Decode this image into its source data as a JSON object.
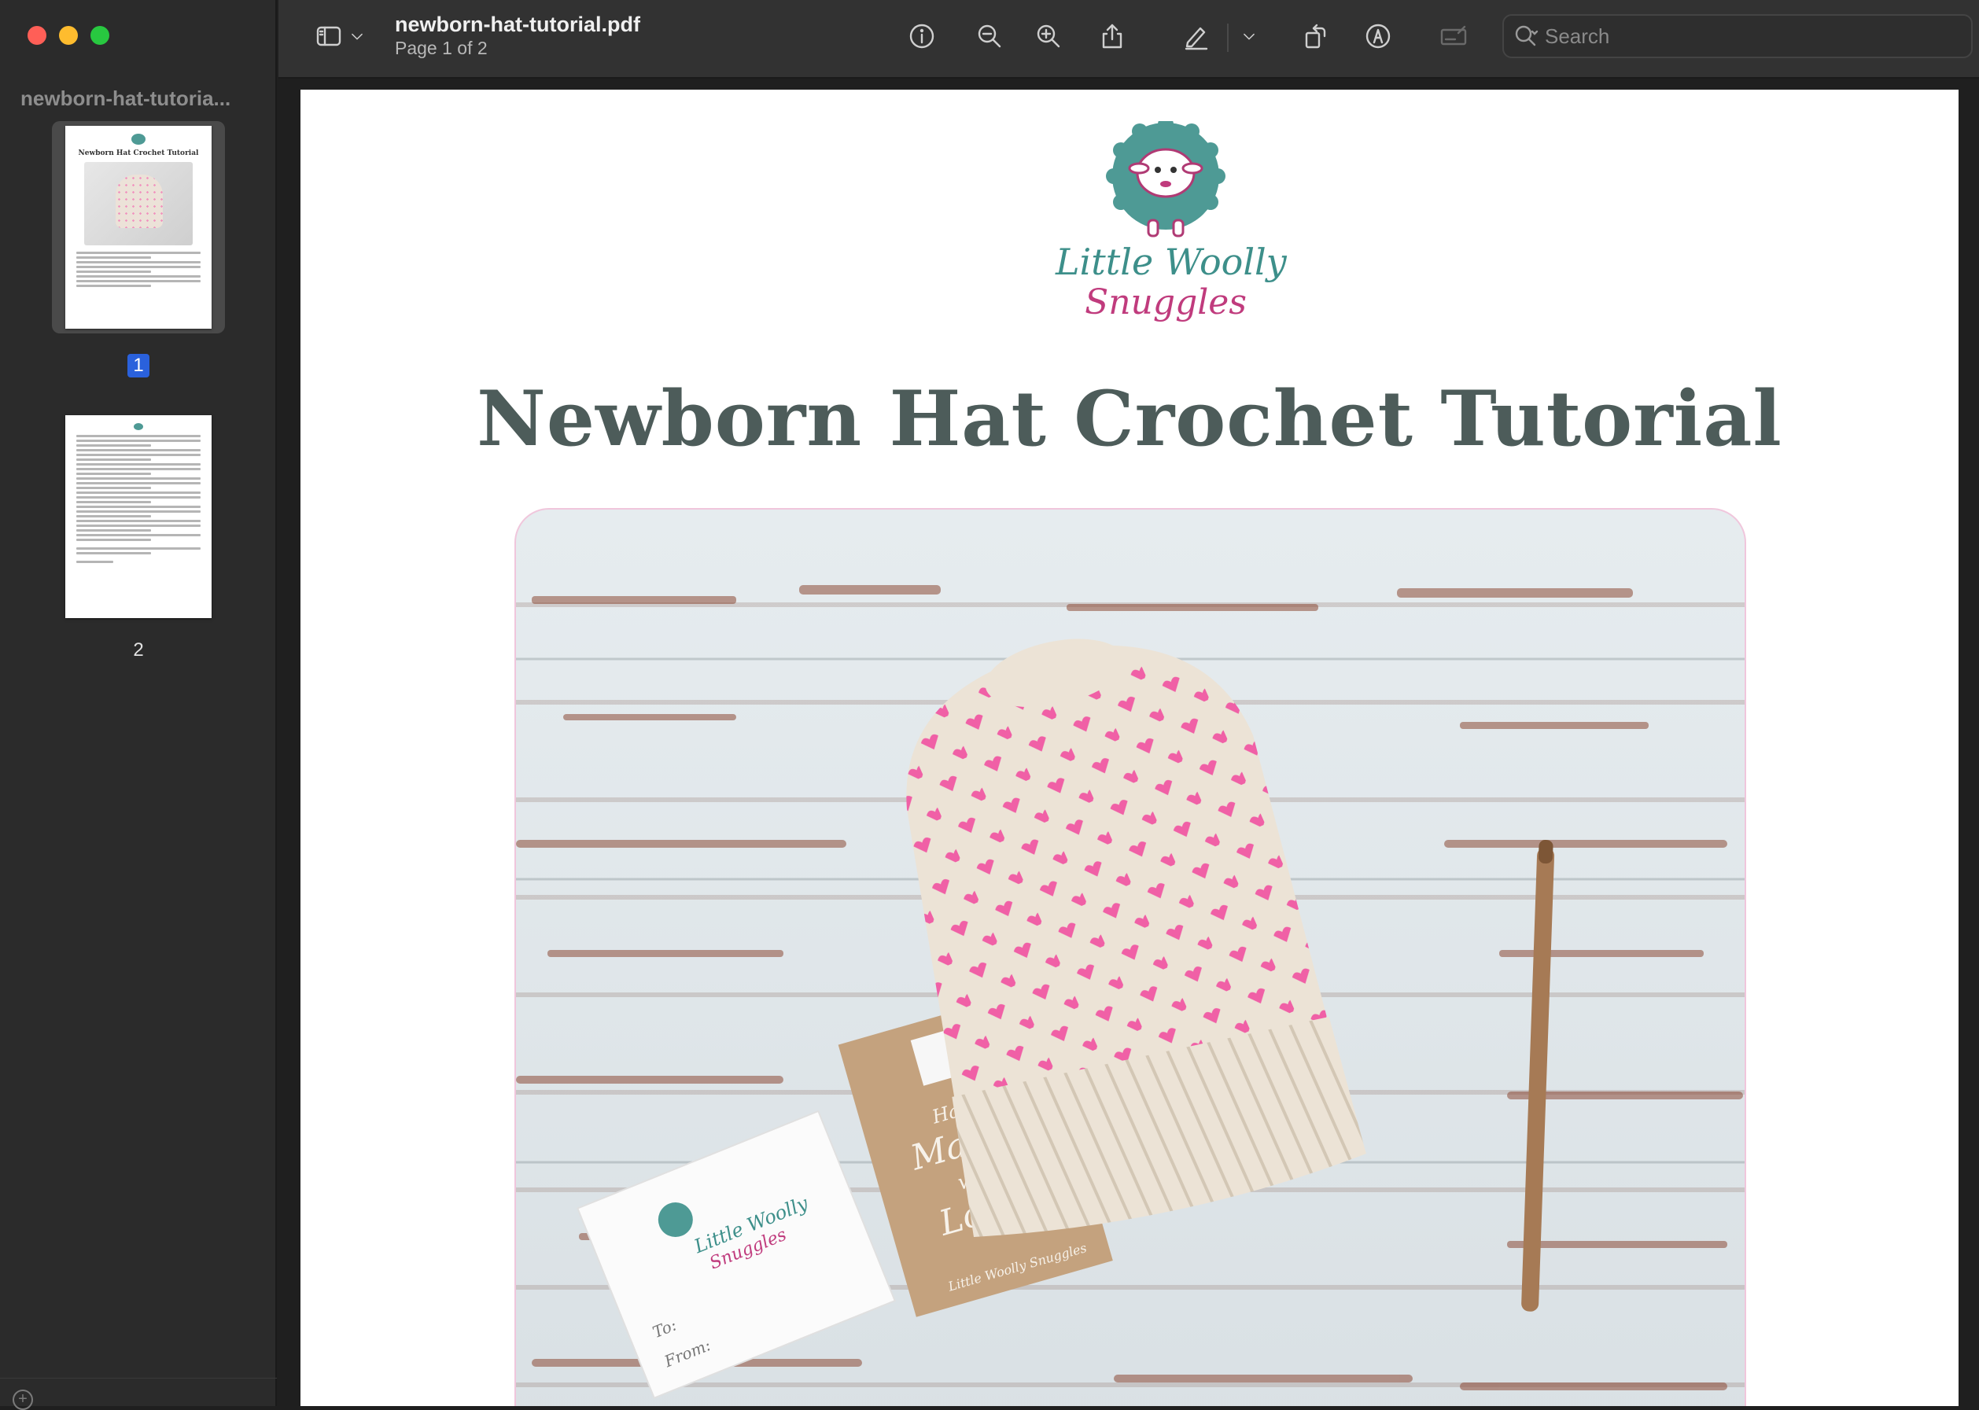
{
  "window": {
    "controls": [
      "close",
      "minimize",
      "zoom"
    ]
  },
  "sidebar": {
    "title": "newborn-hat-tutoria...",
    "pages": [
      {
        "label": "1",
        "selected": true
      },
      {
        "label": "2",
        "selected": false
      }
    ],
    "thumb1_title": "Newborn Hat Crochet Tutorial"
  },
  "toolbar": {
    "filename": "newborn-hat-tutorial.pdf",
    "page_info": "Page 1 of 2",
    "icons": [
      "sidebar-toggle-icon",
      "chevron-down-icon",
      "info-icon",
      "zoom-out-icon",
      "zoom-in-icon",
      "share-icon",
      "markup-pen-icon",
      "chevron-down-icon",
      "rotate-icon",
      "annotate-icon",
      "signature-icon",
      "search-icon"
    ],
    "search_placeholder": "Search"
  },
  "document": {
    "logo_line1": "Little Woolly",
    "logo_line2": "Snuggles",
    "heading": "Newborn Hat Crochet Tutorial",
    "photo_tag": {
      "card_text1": "Little Woolly",
      "card_text2": "Snuggles",
      "card_to": "To:",
      "card_from": "From:",
      "tag_hand": "Hand",
      "tag_made": "Made",
      "tag_with": "with",
      "tag_love": "Love",
      "tag_brand": "Little Woolly Snuggles"
    }
  },
  "colors": {
    "accent_blue": "#2a61dc",
    "heading": "#4d5c5a",
    "logo_teal": "#3d8f8a",
    "logo_pink": "#c03b7d"
  }
}
